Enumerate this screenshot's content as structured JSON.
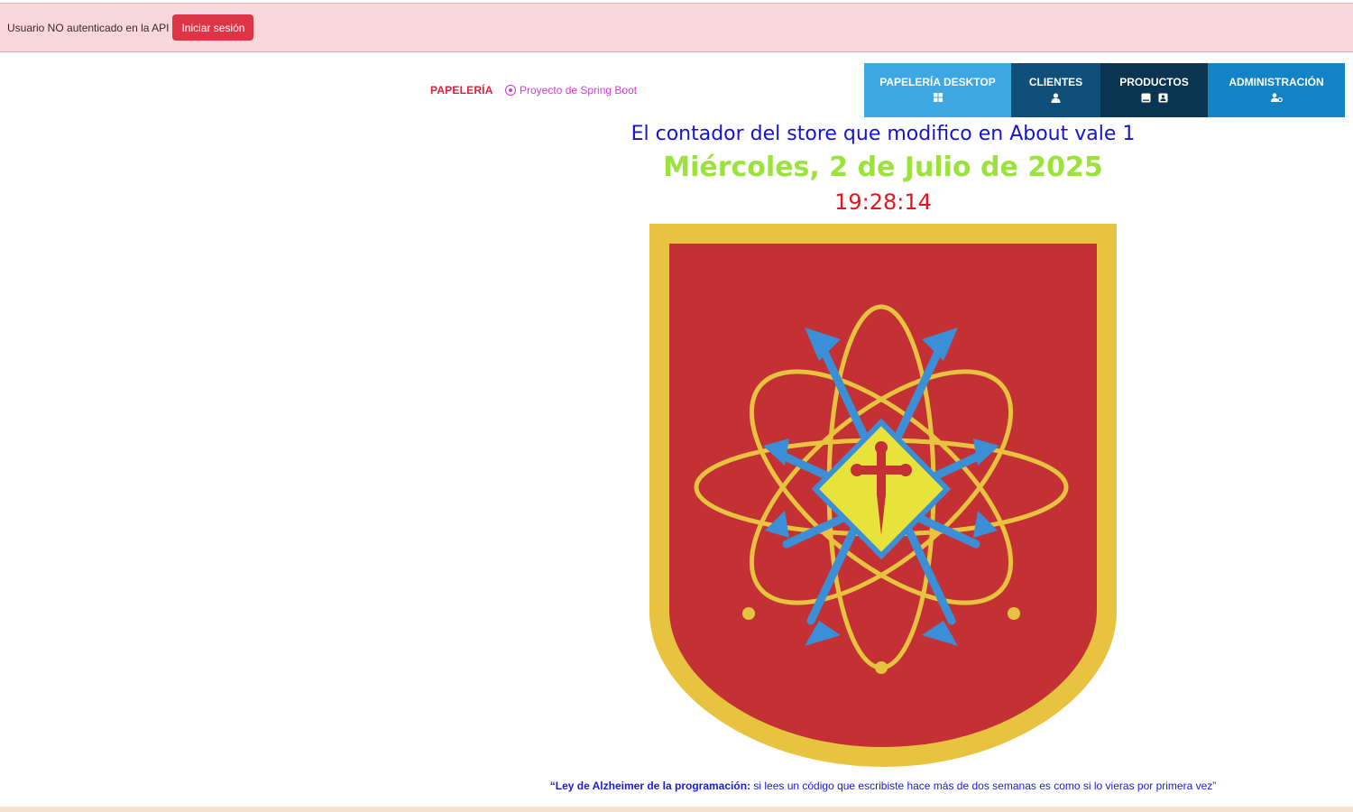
{
  "auth": {
    "status_text": "Usuario NO autenticado en la API",
    "login_label": "Iniciar sesión"
  },
  "header": {
    "brand": "PAPELERÍA",
    "project_link": "Proyecto de Spring Boot"
  },
  "nav": {
    "items": [
      {
        "label": "PAPELERÍA DESKTOP",
        "icons": [
          "windows-icon"
        ],
        "color": "#3ea6e3"
      },
      {
        "label": "CLIENTES",
        "icons": [
          "user-icon"
        ],
        "color": "#0f4f7a"
      },
      {
        "label": "PRODUCTOS",
        "icons": [
          "book-icon",
          "contact-card-icon"
        ],
        "color": "#0a3550"
      },
      {
        "label": "ADMINISTRACIÓN",
        "icons": [
          "user-cog-icon"
        ],
        "color": "#1283c4"
      }
    ]
  },
  "main": {
    "counter_text": "El contador del store que modifico en About vale 1",
    "date_text": "Miércoles, 2 de Julio de 2025",
    "time_text": "19:28:14"
  },
  "footer": {
    "quote_open": "“",
    "quote_bold": "Ley de Alzheimer de la programación:",
    "quote_rest": " si lees un código que escribiste hace más de dos semanas es como si lo vieras por primera vez",
    "quote_close": "”"
  },
  "colors": {
    "auth_bg": "#f8d7da",
    "login_button": "#dc3545",
    "brand": "#dc1f3a",
    "project_link": "#d63ad6",
    "counter": "#1414d2",
    "date": "#9be33b",
    "time": "#e8141c",
    "emblem_red": "#c33135",
    "emblem_gold": "#e8c33f",
    "emblem_blue": "#3a8fd6"
  }
}
